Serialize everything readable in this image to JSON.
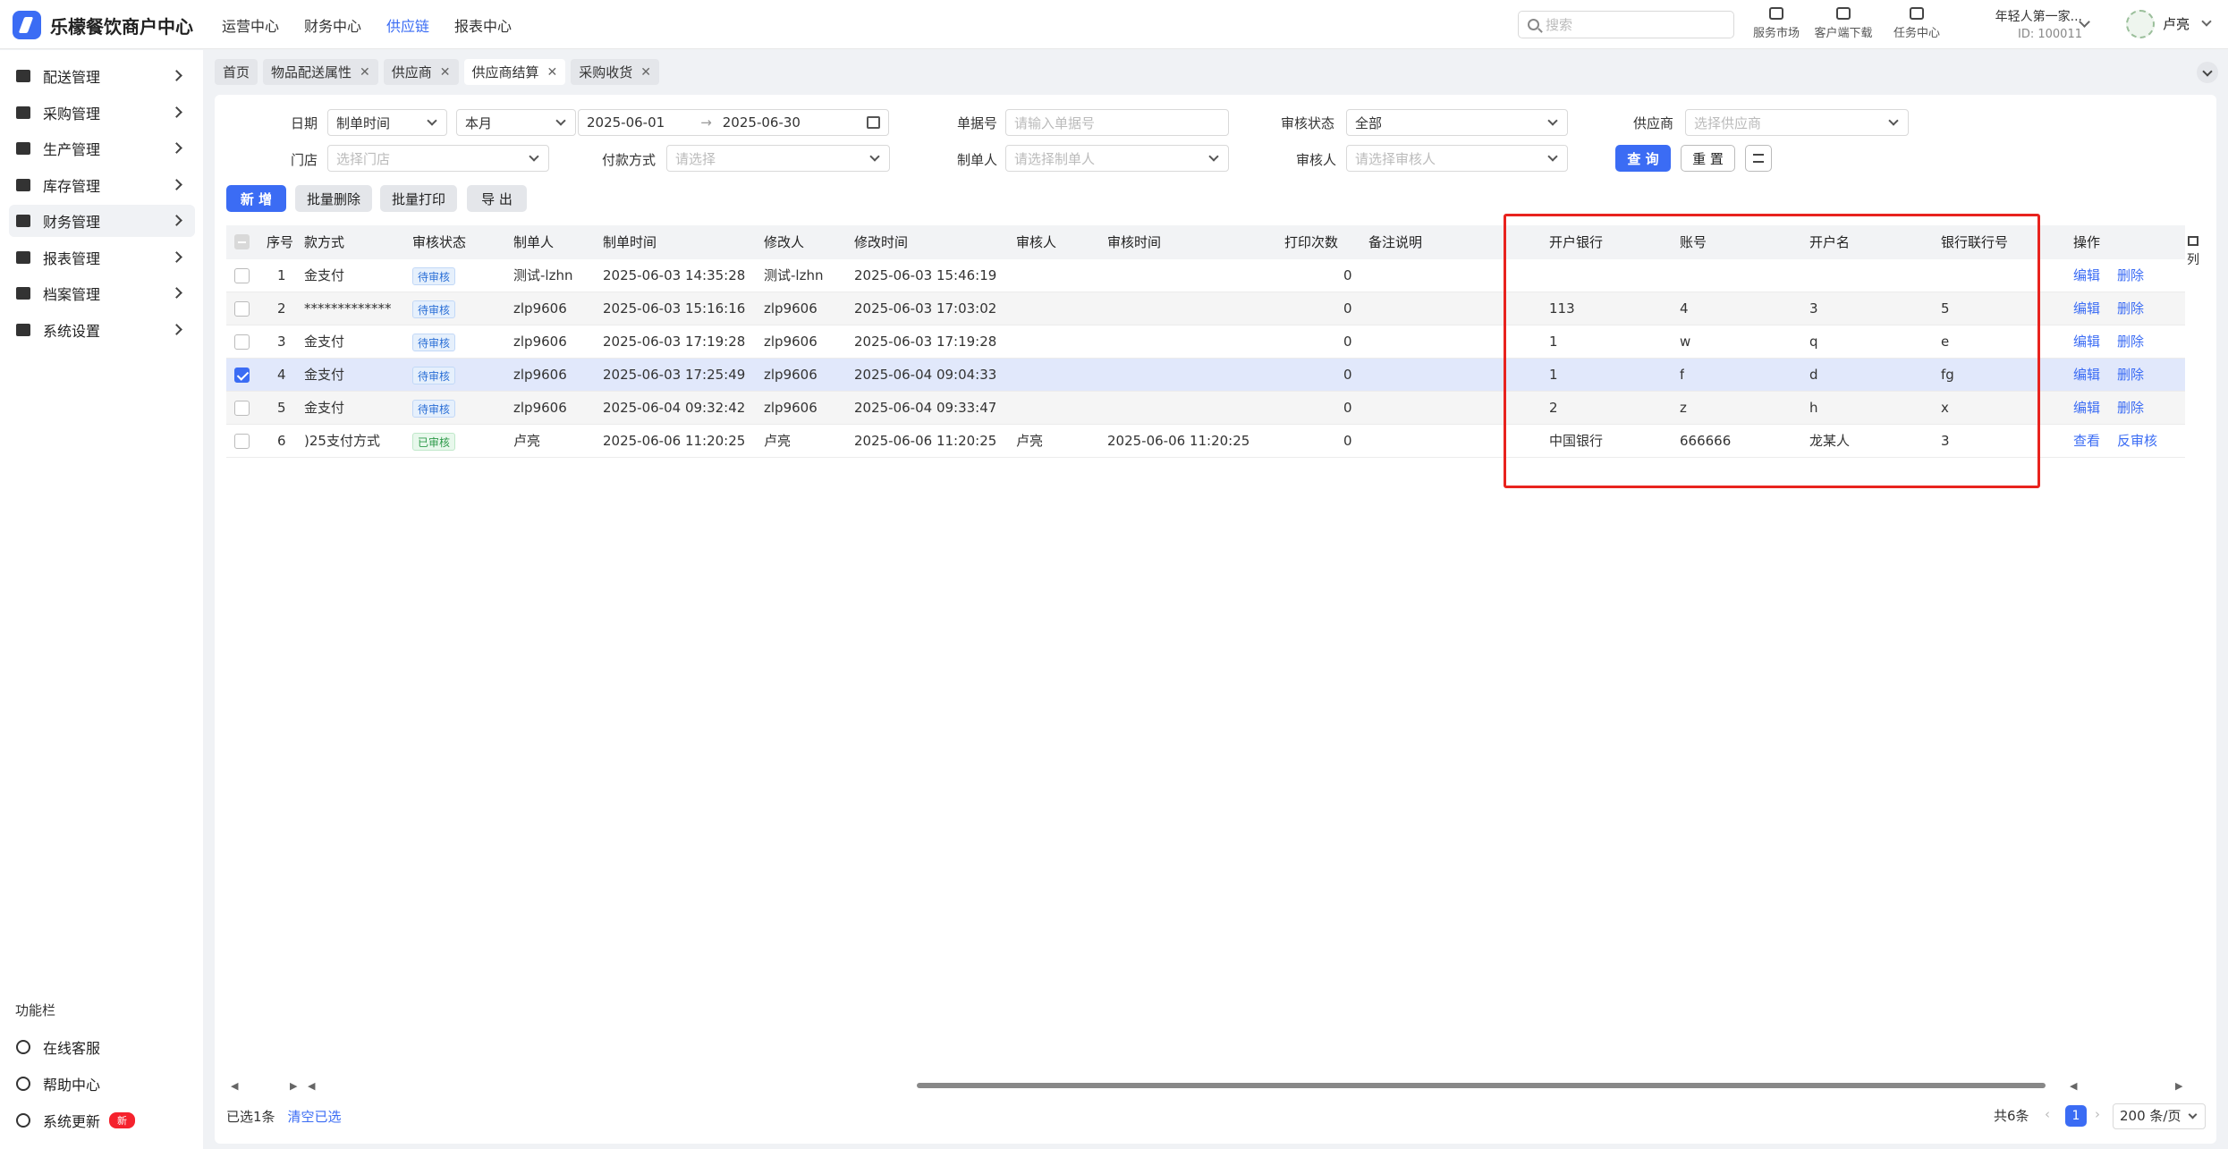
{
  "app": {
    "title": "乐檬餐饮商户中心"
  },
  "topnav": [
    "运营中心",
    "财务中心",
    "供应链",
    "报表中心"
  ],
  "search": {
    "placeholder": "搜索"
  },
  "tools": [
    "服务市场",
    "客户端下载",
    "任务中心"
  ],
  "merchant": {
    "name": "年轻人第一家...",
    "id": "ID: 100011"
  },
  "user": {
    "name": "卢亮"
  },
  "sidebar": {
    "items": [
      "配送管理",
      "采购管理",
      "生产管理",
      "库存管理",
      "财务管理",
      "报表管理",
      "档案管理",
      "系统设置"
    ],
    "func_title": "功能栏",
    "func_items": [
      "在线客服",
      "帮助中心",
      "系统更新"
    ],
    "new_badge": "新"
  },
  "tabs": [
    "首页",
    "物品配送属性",
    "供应商",
    "供应商结算",
    "采购收货"
  ],
  "filters": {
    "date_label": "日期",
    "date_type": "制单时间",
    "date_range": "本月",
    "date_start": "2025-06-01",
    "date_arrow": "→",
    "date_end": "2025-06-30",
    "doc_label": "单据号",
    "doc_placeholder": "请输入单据号",
    "audit_status_label": "审核状态",
    "audit_status_value": "全部",
    "supplier_label": "供应商",
    "supplier_placeholder": "选择供应商",
    "store_label": "门店",
    "store_placeholder": "选择门店",
    "pay_label": "付款方式",
    "pay_placeholder": "请选择",
    "creator_label": "制单人",
    "creator_placeholder": "请选择制单人",
    "auditor_label": "审核人",
    "auditor_placeholder": "请选择审核人",
    "query": "查 询",
    "reset": "重 置"
  },
  "actions": [
    "新 增",
    "批量删除",
    "批量打印",
    "导 出"
  ],
  "table": {
    "headers": [
      "序号",
      "款方式",
      "审核状态",
      "制单人",
      "制单时间",
      "修改人",
      "修改时间",
      "审核人",
      "审核时间",
      "打印次数",
      "备注说明",
      "开户银行",
      "账号",
      "开户名",
      "银行联行号",
      "操作"
    ],
    "rows": [
      {
        "no": "1",
        "pay": "金支付",
        "status": "待审核",
        "creator": "测试-lzhn",
        "ctime": "2025-06-03 14:35:28",
        "modifier": "测试-lzhn",
        "mtime": "2025-06-03 15:46:19",
        "auditor": "",
        "atime": "",
        "prints": "0",
        "remark": "",
        "bank": "",
        "account": "",
        "holder": "",
        "bankno": "",
        "op1": "编辑",
        "op2": "删除"
      },
      {
        "no": "2",
        "pay": "*************",
        "status": "待审核",
        "creator": "zlp9606",
        "ctime": "2025-06-03 15:16:16",
        "modifier": "zlp9606",
        "mtime": "2025-06-03 17:03:02",
        "auditor": "",
        "atime": "",
        "prints": "0",
        "remark": "",
        "bank": "113",
        "account": "4",
        "holder": "3",
        "bankno": "5",
        "op1": "编辑",
        "op2": "删除"
      },
      {
        "no": "3",
        "pay": "金支付",
        "status": "待审核",
        "creator": "zlp9606",
        "ctime": "2025-06-03 17:19:28",
        "modifier": "zlp9606",
        "mtime": "2025-06-03 17:19:28",
        "auditor": "",
        "atime": "",
        "prints": "0",
        "remark": "",
        "bank": "1",
        "account": "w",
        "holder": "q",
        "bankno": "e",
        "op1": "编辑",
        "op2": "删除"
      },
      {
        "no": "4",
        "pay": "金支付",
        "status": "待审核",
        "creator": "zlp9606",
        "ctime": "2025-06-03 17:25:49",
        "modifier": "zlp9606",
        "mtime": "2025-06-04 09:04:33",
        "auditor": "",
        "atime": "",
        "prints": "0",
        "remark": "",
        "bank": "1",
        "account": "f",
        "holder": "d",
        "bankno": "fg",
        "op1": "编辑",
        "op2": "删除"
      },
      {
        "no": "5",
        "pay": "金支付",
        "status": "待审核",
        "creator": "zlp9606",
        "ctime": "2025-06-04 09:32:42",
        "modifier": "zlp9606",
        "mtime": "2025-06-04 09:33:47",
        "auditor": "",
        "atime": "",
        "prints": "0",
        "remark": "",
        "bank": "2",
        "account": "z",
        "holder": "h",
        "bankno": "x",
        "op1": "编辑",
        "op2": "删除"
      },
      {
        "no": "6",
        "pay": ")25支付方式",
        "status": "已审核",
        "creator": "卢亮",
        "ctime": "2025-06-06 11:20:25",
        "modifier": "卢亮",
        "mtime": "2025-06-06 11:20:25",
        "auditor": "卢亮",
        "atime": "2025-06-06 11:20:25",
        "prints": "0",
        "remark": "",
        "bank": "中国银行",
        "account": "666666",
        "holder": "龙某人",
        "bankno": "3",
        "op1": "查看",
        "op2": "反审核"
      }
    ],
    "cols_toggle": "列"
  },
  "footer": {
    "selected": "已选1条",
    "clear": "清空已选",
    "total": "共6条",
    "page": "1",
    "page_size": "200 条/页"
  },
  "colors": {
    "accent": "#3b6cf4",
    "highlight_box": "#e8231e"
  }
}
